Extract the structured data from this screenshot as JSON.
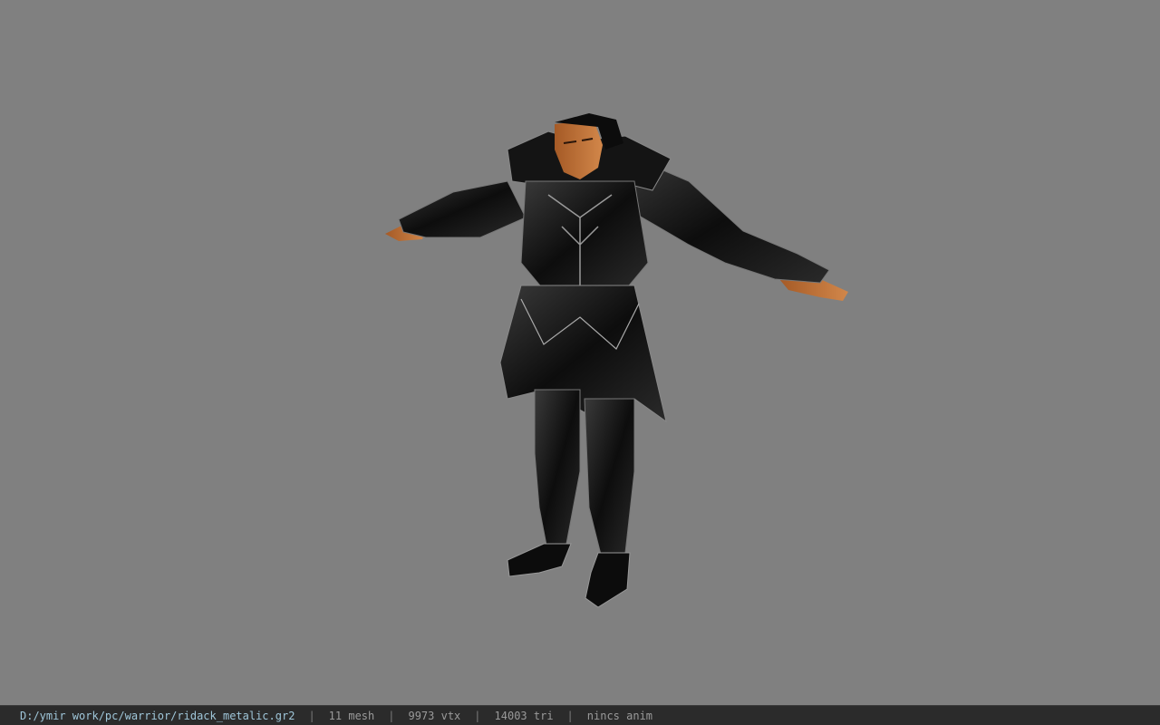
{
  "viewport": {
    "background": "#808080",
    "model_description_icon": "armored-warrior-model"
  },
  "statusbar": {
    "file_path": "D:/ymir work/pc/warrior/ridack_metalic.gr2",
    "separator": "|",
    "mesh_count": "11 mesh",
    "vertex_count": "9973 vtx",
    "triangle_count": "14003 tri",
    "anim_status": "nincs anim",
    "path_color": "#9fc6d9",
    "text_color": "#9a9a9a"
  }
}
